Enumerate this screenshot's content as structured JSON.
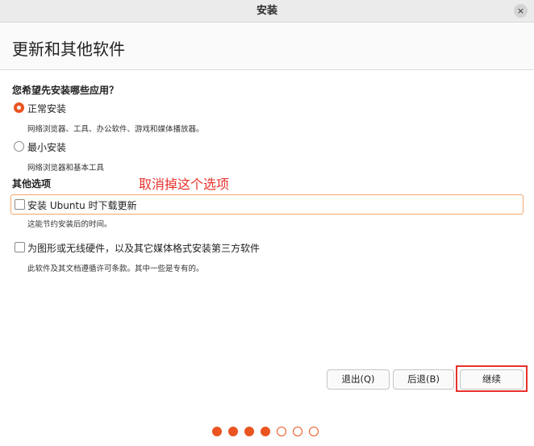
{
  "window": {
    "title": "安装",
    "close_glyph": "×"
  },
  "page": {
    "title": "更新和其他软件"
  },
  "question": "您希望先安装哪些应用？",
  "install_options": [
    {
      "label": "正常安装",
      "description": "网络浏览器、工具、办公软件、游戏和媒体播放器。",
      "selected": true
    },
    {
      "label": "最小安装",
      "description": "网络浏览器和基本工具",
      "selected": false
    }
  ],
  "other_options": {
    "heading": "其他选项",
    "items": [
      {
        "label": "安装 Ubuntu 时下载更新",
        "description": "这能节约安装后的时间。",
        "checked": false
      },
      {
        "label": "为图形或无线硬件，以及其它媒体格式安装第三方软件",
        "description": "此软件及其文档遵循许可条款。其中一些是专有的。",
        "checked": false
      }
    ]
  },
  "annotation": "取消掉这个选项",
  "buttons": {
    "quit": "退出(Q)",
    "back": "后退(B)",
    "continue": "继续"
  },
  "progress": {
    "total_steps": 7,
    "completed_steps": 4
  },
  "colors": {
    "accent": "#e95420",
    "annotation": "#e8322c"
  }
}
